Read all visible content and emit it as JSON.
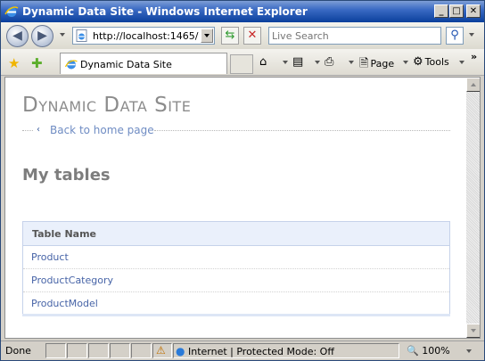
{
  "window": {
    "title": "Dynamic Data Site - Windows Internet Explorer",
    "buttons": {
      "minimize": "_",
      "maximize": "□",
      "close": "✕"
    }
  },
  "nav": {
    "address": "http://localhost:1465/",
    "search_placeholder": "Live Search"
  },
  "toolbar": {
    "tab_label": "Dynamic Data Site",
    "page_label": "Page",
    "tools_label": "Tools",
    "overflow": "»"
  },
  "page": {
    "site_title": "Dynamic Data Site",
    "back_link": "Back to home page",
    "section_title": "My tables",
    "table": {
      "header": "Table Name",
      "rows": [
        "Product",
        "ProductCategory",
        "ProductModel"
      ]
    }
  },
  "status": {
    "text": "Done",
    "zone": "Internet | Protected Mode: Off",
    "zoom": "100%"
  },
  "colors": {
    "title_bar": "#0a3f9c",
    "link": "#4764a7",
    "heading": "#8c8c8c"
  }
}
